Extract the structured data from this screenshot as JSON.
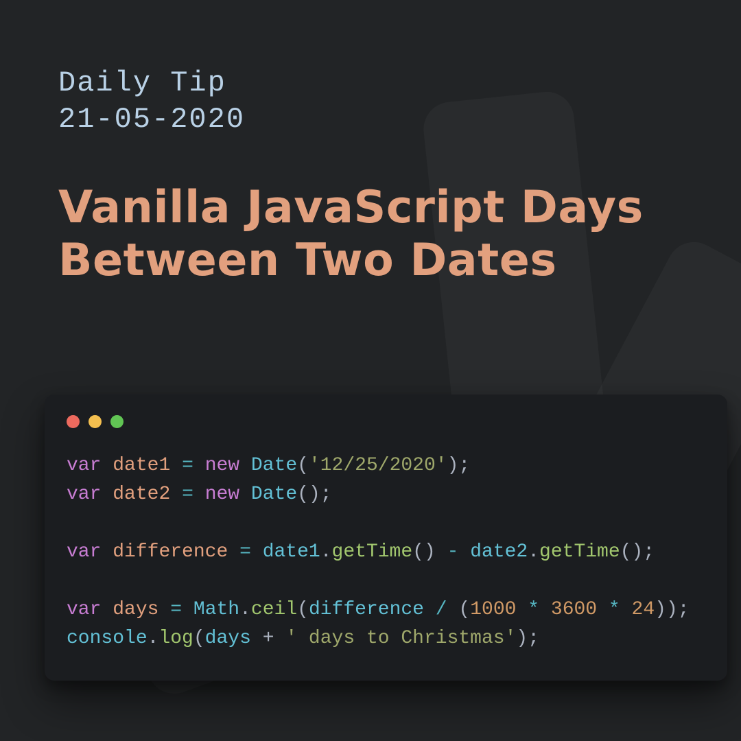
{
  "header": {
    "eyebrow_line1": "Daily Tip",
    "eyebrow_line2": "21-05-2020",
    "title": "Vanilla JavaScript Days Between Two Dates"
  },
  "code": {
    "line1": {
      "kw1": "var",
      "v": "date1",
      "eq": "=",
      "kw2": "new",
      "type": "Date",
      "open": "(",
      "str": "'12/25/2020'",
      "close": ")",
      "semi": ";"
    },
    "line2": {
      "kw1": "var",
      "v": "date2",
      "eq": "=",
      "kw2": "new",
      "type": "Date",
      "open": "(",
      "close": ")",
      "semi": ";"
    },
    "line3": {
      "kw1": "var",
      "v": "difference",
      "eq": "=",
      "a": "date1",
      "dot1": ".",
      "m1": "getTime",
      "p1": "()",
      "minus": "-",
      "b": "date2",
      "dot2": ".",
      "m2": "getTime",
      "p2": "()",
      "semi": ";"
    },
    "line4": {
      "kw1": "var",
      "v": "days",
      "eq": "=",
      "obj": "Math",
      "dot": ".",
      "m": "ceil",
      "open": "(",
      "arg": "difference",
      "div": "/",
      "open2": "(",
      "n1": "1000",
      "star1": "*",
      "n2": "3600",
      "star2": "*",
      "n3": "24",
      "close2": ")",
      "close": ")",
      "semi": ";"
    },
    "line5": {
      "obj": "console",
      "dot": ".",
      "m": "log",
      "open": "(",
      "arg": "days",
      "plus": "+",
      "str": "' days to Christmas'",
      "close": ")",
      "semi": ";"
    }
  }
}
